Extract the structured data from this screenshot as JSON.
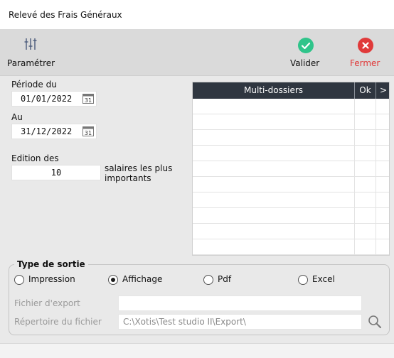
{
  "window": {
    "title": "Relevé des Frais Généraux"
  },
  "toolbar": {
    "parametrer_label": "Paramétrer",
    "valider_label": "Valider",
    "fermer_label": "Fermer",
    "fermer_color": "#e03a3a",
    "valider_color": "#2fc48a"
  },
  "form": {
    "periode_label": "Période du",
    "periode_value": "01/01/2022",
    "au_label": "Au",
    "au_value": "31/12/2022",
    "calendar_day": "31",
    "edition_label": "Edition des",
    "edition_value": "10",
    "salaires_label_1": "salaires les plus",
    "salaires_label_2": "importants"
  },
  "grid": {
    "col_dossiers": "Multi-dossiers",
    "col_ok": "Ok",
    "scroll_glyph": ">",
    "row_count": 10
  },
  "sortie": {
    "group_label": "Type de sortie",
    "options": [
      "Impression",
      "Affichage",
      "Pdf",
      "Excel"
    ],
    "selected": "Affichage",
    "fichier_label": "Fichier d'export",
    "fichier_value": "",
    "repertoire_label": "Répertoire du fichier",
    "repertoire_value": "C:\\Xotis\\Test studio II\\Export\\"
  }
}
